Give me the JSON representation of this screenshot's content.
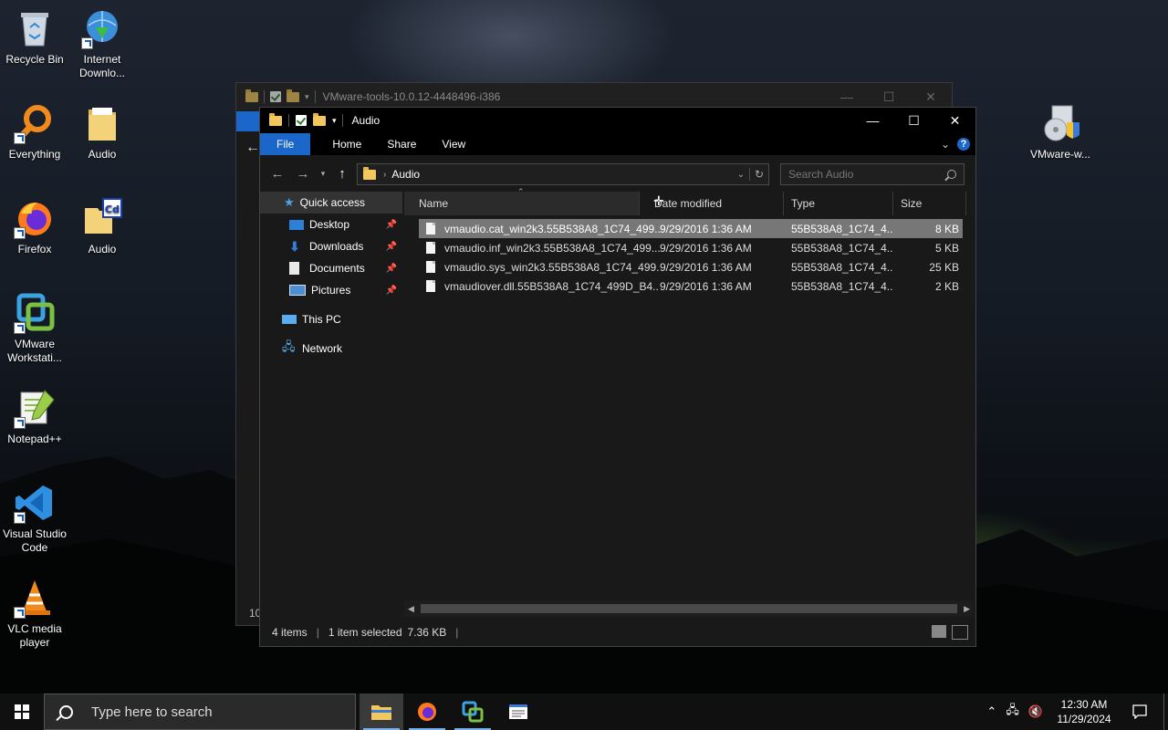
{
  "desktop": {
    "icons": [
      {
        "label": "Recycle Bin"
      },
      {
        "label": "Internet Downlo..."
      },
      {
        "label": "Everything"
      },
      {
        "label": "Audio"
      },
      {
        "label": "Firefox"
      },
      {
        "label": "Audio"
      },
      {
        "label": "VMware Workstati..."
      },
      {
        "label": "Notepad++"
      },
      {
        "label": "Visual Studio Code"
      },
      {
        "label": "VLC media player"
      },
      {
        "label": "VMware-w..."
      }
    ]
  },
  "back_window": {
    "title": "VMware-tools-10.0.12-4448496-i386",
    "status_fragment": "10"
  },
  "window": {
    "title": "Audio",
    "ribbon_tabs": [
      "File",
      "Home",
      "Share",
      "View"
    ],
    "address": {
      "crumb": "Audio"
    },
    "search": {
      "placeholder": "Search Audio"
    },
    "nav_pane": {
      "quick_access": "Quick access",
      "items": [
        "Desktop",
        "Downloads",
        "Documents",
        "Pictures"
      ],
      "this_pc": "This PC",
      "network": "Network"
    },
    "columns": [
      "Name",
      "Date modified",
      "Type",
      "Size"
    ],
    "files": [
      {
        "name": "vmaudio.cat_win2k3.55B538A8_1C74_499...",
        "date": "9/29/2016 1:36 AM",
        "type": "55B538A8_1C74_4...",
        "size": "8 KB",
        "selected": true
      },
      {
        "name": "vmaudio.inf_win2k3.55B538A8_1C74_499...",
        "date": "9/29/2016 1:36 AM",
        "type": "55B538A8_1C74_4...",
        "size": "5 KB",
        "selected": false
      },
      {
        "name": "vmaudio.sys_win2k3.55B538A8_1C74_499...",
        "date": "9/29/2016 1:36 AM",
        "type": "55B538A8_1C74_4...",
        "size": "25 KB",
        "selected": false
      },
      {
        "name": "vmaudiover.dll.55B538A8_1C74_499D_B4...",
        "date": "9/29/2016 1:36 AM",
        "type": "55B538A8_1C74_4...",
        "size": "2 KB",
        "selected": false
      }
    ],
    "status": {
      "items": "4 items",
      "selected": "1 item selected",
      "size": "7.36 KB"
    }
  },
  "taskbar": {
    "search_placeholder": "Type here to search",
    "time": "12:30 AM",
    "date": "11/29/2024"
  },
  "colors": {
    "accent": "#1b66c9",
    "folder": "#f2c75c",
    "selected_row": "#777777"
  }
}
